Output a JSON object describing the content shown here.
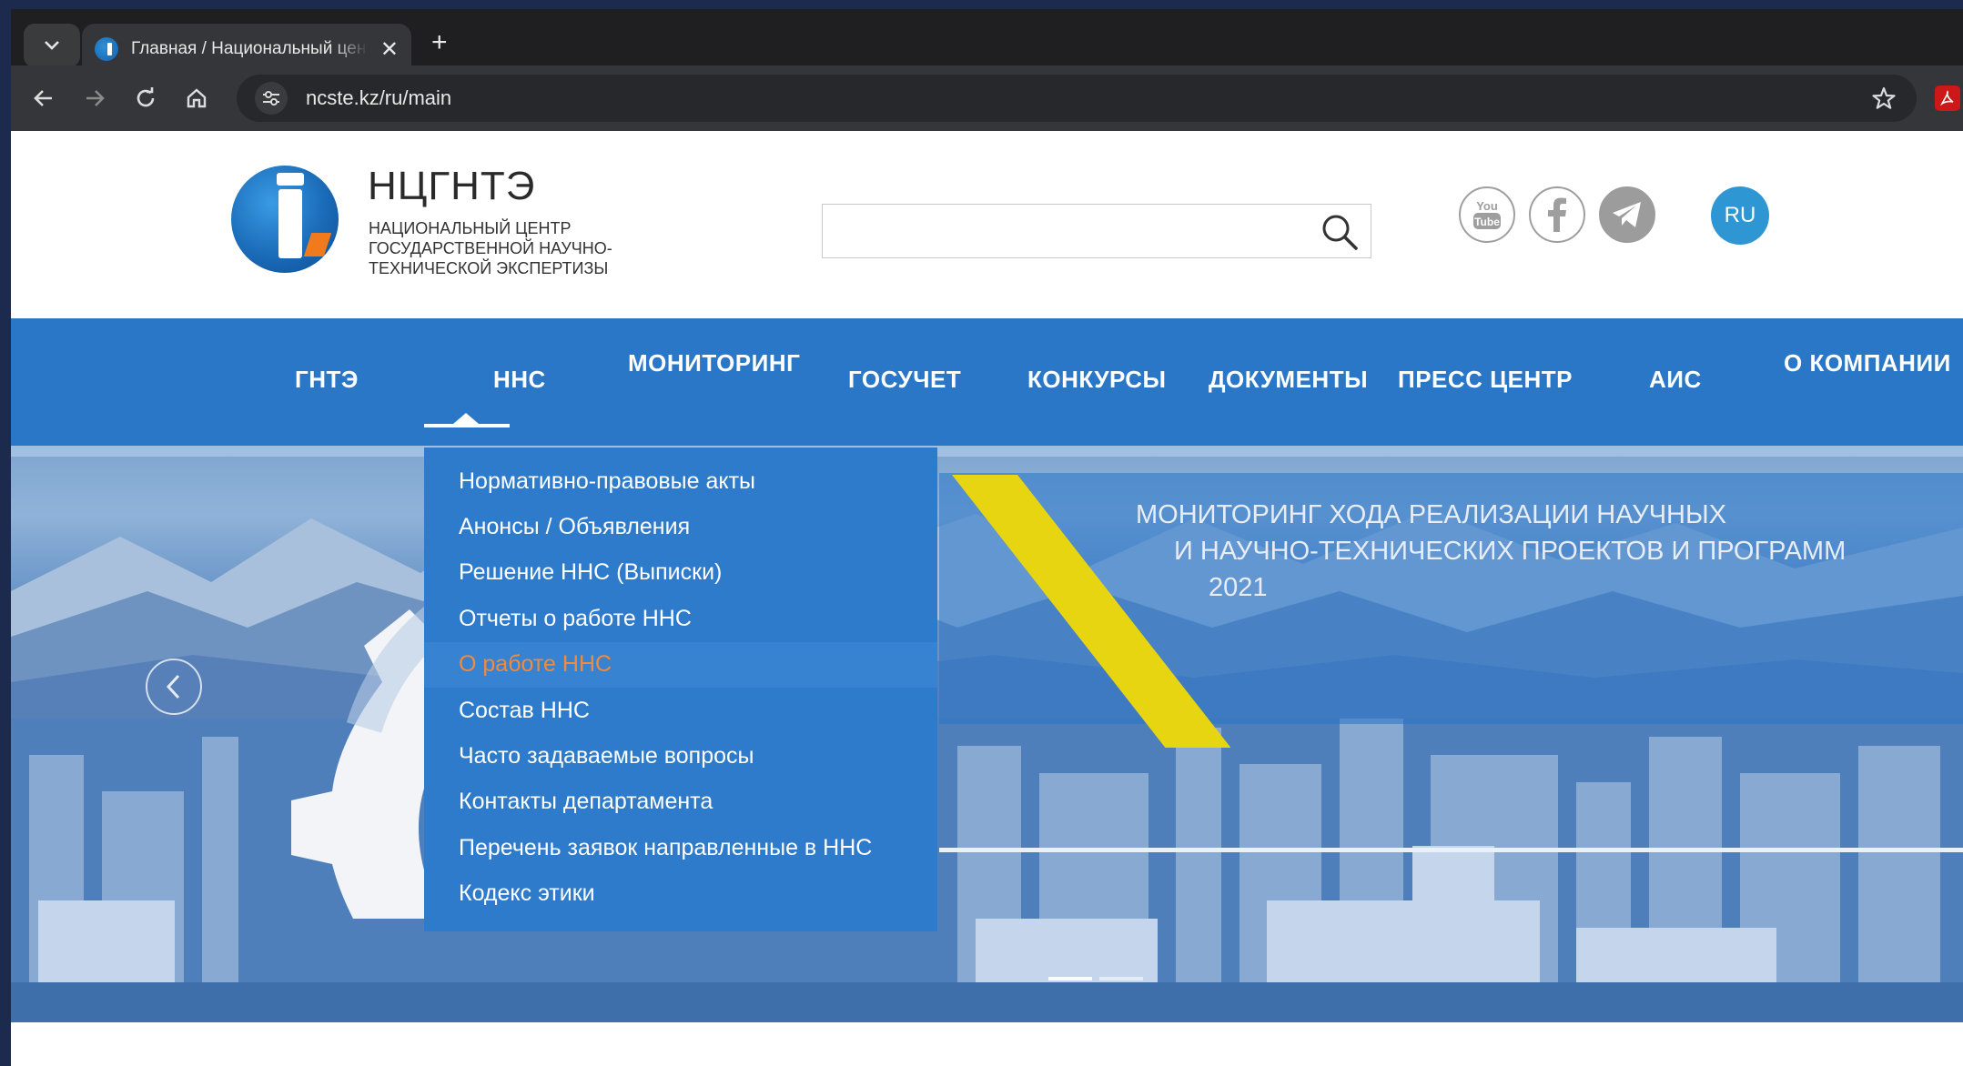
{
  "browser": {
    "tab_title": "Главная / Национальный центр",
    "url": "ncste.kz/ru/main"
  },
  "header": {
    "brand_title": "НЦГНТЭ",
    "brand_subtitle_lines": [
      "НАЦИОНАЛЬНЫЙ ЦЕНТР",
      "ГОСУДАРСТВЕННОЙ НАУЧНО-",
      "ТЕХНИЧЕСКОЙ ЭКСПЕРТИЗЫ"
    ],
    "search_value": "",
    "language": "RU"
  },
  "nav": {
    "items": [
      {
        "label": "ГНТЭ"
      },
      {
        "label": "ННС"
      },
      {
        "label": "МОНИТОРИНГ"
      },
      {
        "label": "ГОСУЧЕТ"
      },
      {
        "label": "КОНКУРСЫ"
      },
      {
        "label": "ДОКУМЕНТЫ"
      },
      {
        "label": "ПРЕСС ЦЕНТР"
      },
      {
        "label": "АИС"
      },
      {
        "label": "О КОМПАНИИ"
      }
    ],
    "active": "ННС"
  },
  "dropdown": {
    "items": [
      {
        "label": "Нормативно-правовые акты"
      },
      {
        "label": "Анонсы / Объявления"
      },
      {
        "label": "Решение ННС (Выписки)"
      },
      {
        "label": "Отчеты о работе ННС"
      },
      {
        "label": "О работе ННС"
      },
      {
        "label": "Состав ННС"
      },
      {
        "label": "Часто задаваемые вопросы"
      },
      {
        "label": "Контакты департамента"
      },
      {
        "label": "Перечень заявок направленные в ННС"
      },
      {
        "label": "Кодекс этики"
      }
    ],
    "highlighted": "О работе ННС"
  },
  "hero": {
    "line1": "МОНИТОРИНГ ХОДА РЕАЛИЗАЦИИ НАУЧНЫХ",
    "line2": "И НАУЧНО-ТЕХНИЧЕСКИХ ПРОЕКТОВ И ПРОГРАММ",
    "line3": "2021"
  },
  "colors": {
    "nav_bg": "#2b77c7",
    "dropdown_bg": "#2e7bcc",
    "highlight_text": "#f08a3c",
    "accent_yellow": "#e7d512",
    "lang_badge": "#2f96d4"
  },
  "icons": {
    "social": [
      "youtube-icon",
      "facebook-icon",
      "telegram-icon"
    ]
  }
}
